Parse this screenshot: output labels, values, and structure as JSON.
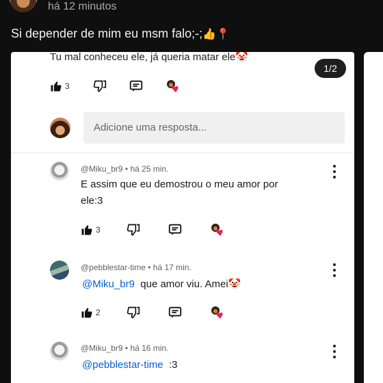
{
  "post": {
    "time": "há 12 minutos",
    "text": "Si depender de mim eu msm falo;-;",
    "emojis": "👍📍"
  },
  "card": {
    "top_comment": "Tu mal conheceu ele, já queria matar ele",
    "top_comment_emoji": "🤡",
    "counter": "1/2",
    "top_actions": {
      "like_count": "3"
    },
    "reply_placeholder": "Adicione uma resposta...",
    "comments": [
      {
        "author": "@Miku_br9",
        "time": "há 25 min.",
        "text_line1": "E assim que eu demostrou o meu amor por",
        "text_line2": "ele:3",
        "like_count": "3"
      },
      {
        "author": "@pebblestar-time",
        "time": "há 17 min.",
        "mention": "@Miku_br9",
        "text": "que amor viu. Amei",
        "emoji": "🤡",
        "like_count": "2"
      },
      {
        "author": "@Miku_br9",
        "time": "há 16 min.",
        "mention": "@pebblestar-time",
        "text": ":3"
      }
    ],
    "separator": "•"
  },
  "icons": [
    "like-icon",
    "dislike-icon",
    "reply-icon",
    "creator-heart-icon",
    "more-options-icon"
  ],
  "colors": {
    "background": "#0f0f0f",
    "card": "#ffffff",
    "mention": "#065fd4",
    "heart": "#e0245e"
  }
}
